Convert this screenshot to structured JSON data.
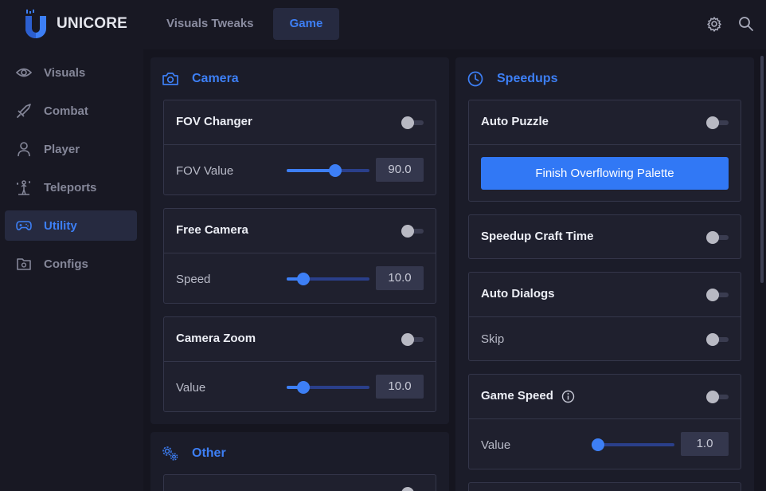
{
  "app": {
    "name": "UNICORE"
  },
  "top_tabs": [
    {
      "label": "Visuals Tweaks",
      "active": false
    },
    {
      "label": "Game",
      "active": true
    }
  ],
  "header_icons": [
    "gear-icon",
    "search-icon"
  ],
  "sidebar": {
    "items": [
      {
        "label": "Visuals",
        "icon": "eye-icon",
        "active": false
      },
      {
        "label": "Combat",
        "icon": "sword-icon",
        "active": false
      },
      {
        "label": "Player",
        "icon": "person-icon",
        "active": false
      },
      {
        "label": "Teleports",
        "icon": "teleport-icon",
        "active": false
      },
      {
        "label": "Utility",
        "icon": "gamepad-icon",
        "active": true
      },
      {
        "label": "Configs",
        "icon": "folder-gear-icon",
        "active": false
      }
    ]
  },
  "camera_panel": {
    "title": "Camera",
    "icon": "camera-icon",
    "fov_changer": {
      "label": "FOV Changer",
      "enabled": false,
      "value_label": "FOV Value",
      "value": "90.0",
      "level": 0.6
    },
    "free_camera": {
      "label": "Free Camera",
      "enabled": false,
      "value_label": "Speed",
      "value": "10.0",
      "level": 0.15
    },
    "camera_zoom": {
      "label": "Camera Zoom",
      "enabled": false,
      "value_label": "Value",
      "value": "10.0",
      "level": 0.15
    }
  },
  "other_panel": {
    "title": "Other",
    "icon": "gears-icon"
  },
  "speedups_panel": {
    "title": "Speedups",
    "icon": "clock-icon",
    "auto_puzzle": {
      "label": "Auto Puzzle",
      "enabled": false,
      "button_label": "Finish Overflowing Palette"
    },
    "speedup_craft_time": {
      "label": "Speedup Craft Time",
      "enabled": false
    },
    "auto_dialogs": {
      "label": "Auto Dialogs",
      "enabled": false,
      "skip_label": "Skip",
      "skip_enabled": false
    },
    "game_speed": {
      "label": "Game Speed",
      "info_icon": "info-icon",
      "enabled": false,
      "value_label": "Value",
      "value": "1.0",
      "level": 0.0
    }
  },
  "colors": {
    "accent": "#3d7ff5",
    "background": "#15151f",
    "panel": "#1b1c29",
    "card": "#1f202e",
    "border": "#34364a"
  }
}
